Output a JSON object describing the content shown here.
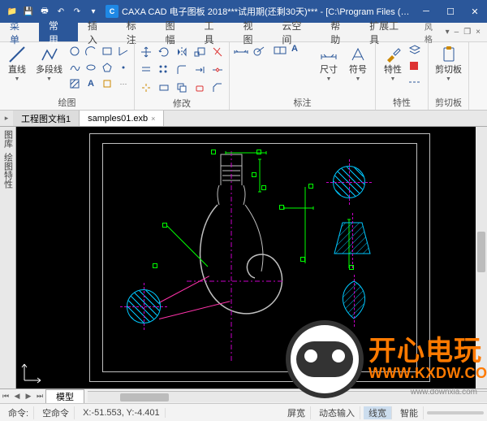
{
  "title": "CAXA CAD 电子图板 2018***试用期(还剩30天)*** - [C:\\Program Files (x...",
  "qat_icons": [
    "folder",
    "save",
    "print",
    "undo",
    "redo",
    "open",
    "new"
  ],
  "tabs": {
    "menu": "菜单",
    "items": [
      "常用",
      "插入",
      "标注",
      "图幅",
      "工具",
      "视图",
      "云空间",
      "帮助",
      "扩展工具"
    ],
    "active": "常用",
    "right_label": "风格"
  },
  "ribbon": {
    "groups": [
      {
        "name": "绘图",
        "big": [
          {
            "id": "line",
            "label": "直线"
          },
          {
            "id": "polyline",
            "label": "多段线"
          }
        ]
      },
      {
        "name": "修改"
      },
      {
        "name": "标注",
        "big": [
          {
            "id": "dim",
            "label": "尺寸"
          },
          {
            "id": "sym",
            "label": "符号"
          }
        ]
      },
      {
        "name": "特性",
        "big": [
          {
            "id": "props",
            "label": "特性"
          }
        ]
      },
      {
        "name": "剪切板",
        "big": [
          {
            "id": "clip",
            "label": "剪切板"
          }
        ]
      }
    ]
  },
  "doctabs": [
    {
      "label": "工程图文档1",
      "active": false
    },
    {
      "label": "samples01.exb",
      "active": true
    }
  ],
  "left_panels": [
    "图库",
    "绘图特性"
  ],
  "status": {
    "cmd_prompt": "命令:",
    "cmd_value": "命令:",
    "blank": "空命令",
    "coords": "X:-51.553, Y:-4.401",
    "items": [
      "屏宽",
      "动态输入",
      "线宽",
      "智能"
    ]
  },
  "model_tab": "模型",
  "overlay": {
    "ch": "开心电玩",
    "en": "WWW.KXDW.COI"
  },
  "watermark": "www.downxia.com"
}
